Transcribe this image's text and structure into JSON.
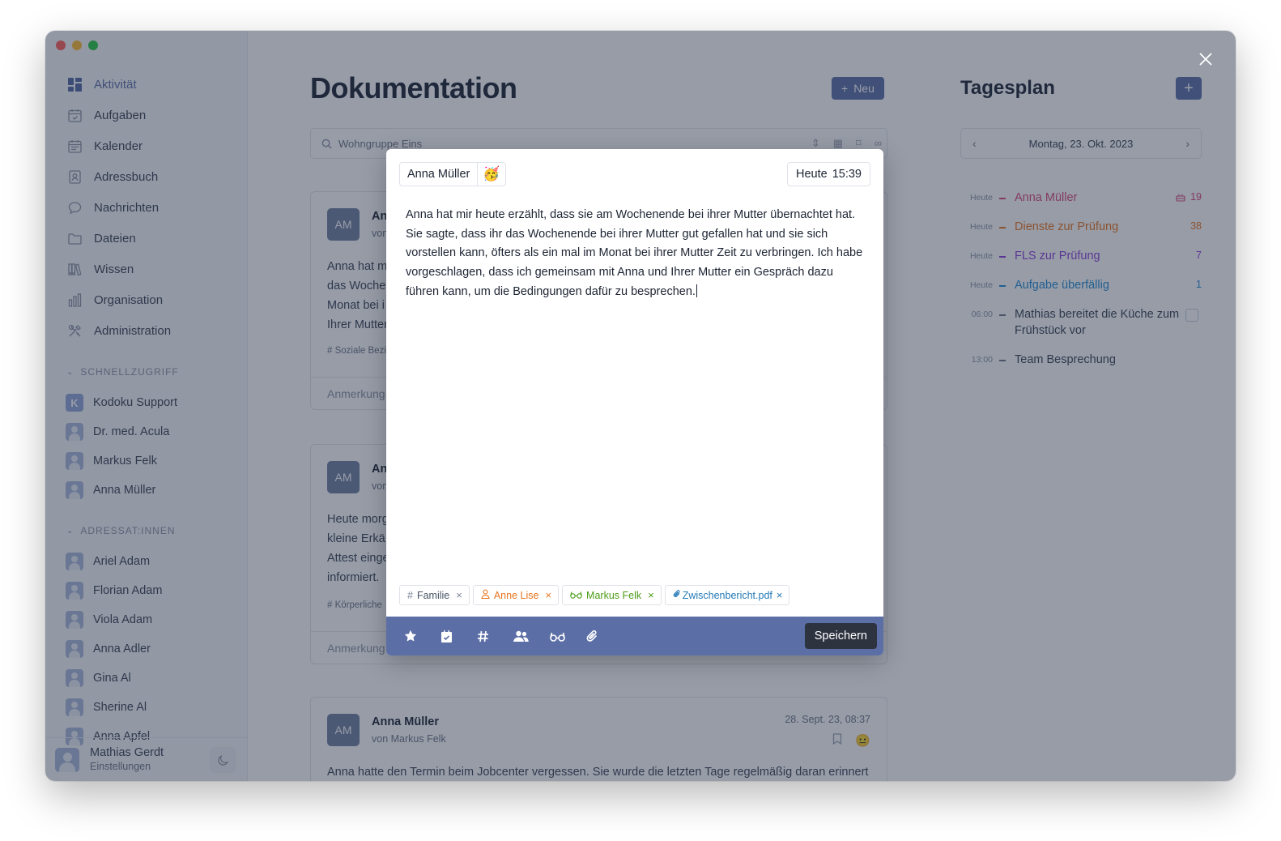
{
  "sidebar": {
    "nav": [
      {
        "label": "Aktivität",
        "icon": "dashboard-icon"
      },
      {
        "label": "Aufgaben",
        "icon": "calendar-check-icon"
      },
      {
        "label": "Kalender",
        "icon": "calendar-icon"
      },
      {
        "label": "Adressbuch",
        "icon": "contact-book-icon"
      },
      {
        "label": "Nachrichten",
        "icon": "chat-bubble-icon"
      },
      {
        "label": "Dateien",
        "icon": "folder-icon"
      },
      {
        "label": "Wissen",
        "icon": "books-icon"
      },
      {
        "label": "Organisation",
        "icon": "bar-chart-icon"
      },
      {
        "label": "Administration",
        "icon": "tools-icon"
      }
    ],
    "quick_title": "SCHNELLZUGRIFF",
    "quick": [
      {
        "label": "Kodoku Support",
        "initial": "K"
      },
      {
        "label": "Dr. med. Acula"
      },
      {
        "label": "Markus Felk"
      },
      {
        "label": "Anna Müller"
      }
    ],
    "recipients_title": "ADRESSAT:INNEN",
    "recipients": [
      "Ariel Adam",
      "Florian Adam",
      "Viola Adam",
      "Anna Adler",
      "Gina Al",
      "Sherine Al",
      "Anna Apfel"
    ],
    "footer": {
      "name": "Mathias Gerdt",
      "sub": "Einstellungen"
    }
  },
  "main": {
    "title": "Dokumentation",
    "new_button": "Neu",
    "search_value": "Wohngruppe Eins",
    "cards": [
      {
        "avatar": "AM",
        "name": "An",
        "from": "von",
        "text": [
          "Anna hat m",
          "das Woche",
          "Monat bei i",
          "Ihrer Mutter"
        ],
        "tag": "# Soziale Bezi",
        "note": "Anmerkung"
      },
      {
        "avatar": "AM",
        "name": "An",
        "from": "von",
        "text": [
          "Heute morg",
          "kleine Erkä",
          "Attest einge",
          "informiert."
        ],
        "tag": "# Körperliche",
        "note": "Anmerkung"
      },
      {
        "avatar": "AM",
        "name": "Anna Müller",
        "from": "von Markus Felk",
        "date": "28. Sept. 23, 08:37",
        "text": [
          "Anna hatte den Termin beim Jobcenter vergessen. Sie wurde die letzten Tage regelmäßig daran erinnert"
        ]
      }
    ]
  },
  "tagesplan": {
    "title": "Tagesplan",
    "add": "+",
    "date": "Montag, 23. Okt. 2023",
    "items": [
      {
        "time": "Heute",
        "label": "Anna Müller",
        "count": "19",
        "color": "#d9467a",
        "extra_icon": "cake-icon"
      },
      {
        "time": "Heute",
        "label": "Dienste zur Prüfung",
        "count": "38",
        "color": "#e8731c"
      },
      {
        "time": "Heute",
        "label": "FLS zur Prüfung",
        "count": "7",
        "color": "#8b3fd9"
      },
      {
        "time": "Heute",
        "label": "Aufgabe überfällig",
        "count": "1",
        "color": "#1f8ad1"
      },
      {
        "time": "06:00",
        "label": "Mathias bereitet die Küche zum Frühstück vor",
        "color": "#384152",
        "checkbox": true
      },
      {
        "time": "13:00",
        "label": "Team Besprechung",
        "color": "#384152"
      }
    ]
  },
  "modal": {
    "person": "Anna Müller",
    "mood_emoji": "🥳",
    "time_day": "Heute",
    "time_clock": "15:39",
    "text": [
      "Anna hat mir heute erzählt, dass sie am Wochenende bei ihrer Mutter übernachtet hat.",
      "Sie sagte, dass ihr das Wochenende bei ihrer Mutter gut gefallen hat und sie sich",
      "vorstellen kann, öfters als ein mal im Monat bei ihrer Mutter Zeit zu verbringen. Ich habe",
      "vorgeschlagen, dass ich gemeinsam mit Anna und Ihrer Mutter ein Gespräch dazu",
      "führen kann, um die Bedingungen dafür zu besprechen."
    ],
    "chips": [
      {
        "label": "Familie",
        "kind": "tag"
      },
      {
        "label": "Anne Lise",
        "kind": "person"
      },
      {
        "label": "Markus Felk",
        "kind": "observer"
      },
      {
        "label": "Zwischenbericht.pdf",
        "kind": "file"
      }
    ],
    "toolbar": [
      "star-icon",
      "calendar-check-icon",
      "hashtag-icon",
      "people-icon",
      "glasses-icon",
      "paperclip-icon"
    ],
    "save": "Speichern"
  }
}
